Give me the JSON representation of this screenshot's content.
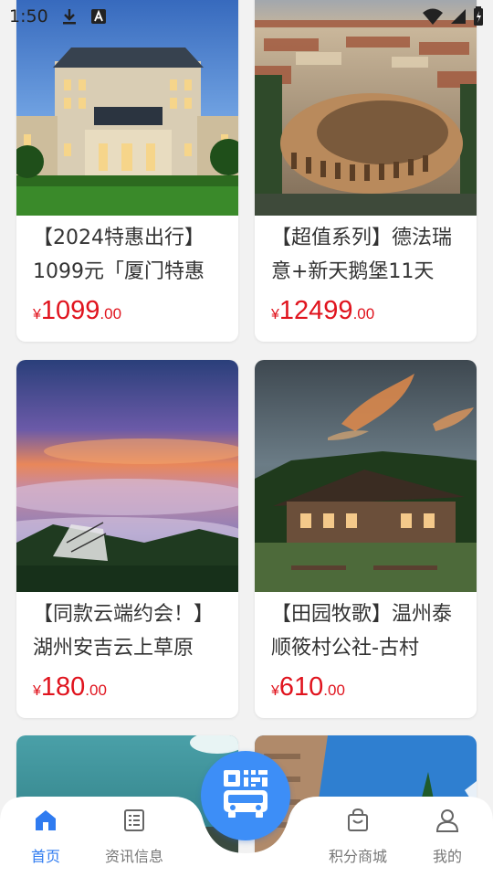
{
  "status_bar": {
    "time": "1:50"
  },
  "cards": [
    {
      "title": "【2024特惠出行】1099元「厦门特惠",
      "price_symbol": "¥",
      "price_int": "1099",
      "price_dec": ".00"
    },
    {
      "title": "【超值系列】德法瑞意+新天鹅堡11天",
      "price_symbol": "¥",
      "price_int": "12499",
      "price_dec": ".00"
    },
    {
      "title": "【同款云端约会！】湖州安吉云上草原",
      "price_symbol": "¥",
      "price_int": "180",
      "price_dec": ".00"
    },
    {
      "title": "【田园牧歌】温州泰顺筱村公社-古村",
      "price_symbol": "¥",
      "price_int": "610",
      "price_dec": ".00"
    }
  ],
  "bottom_nav": {
    "items": [
      {
        "label": "首页",
        "icon": "home-icon",
        "active": true
      },
      {
        "label": "资讯信息",
        "icon": "news-icon",
        "active": false
      },
      {
        "label": "积分商城",
        "icon": "shopping-bag-icon",
        "active": false
      },
      {
        "label": "我的",
        "icon": "person-icon",
        "active": false
      }
    ],
    "center_button_icon": "bus-qr-icon"
  },
  "colors": {
    "price": "#e0141e",
    "accent": "#2f7bf0",
    "fab": "#3d8ef7"
  }
}
